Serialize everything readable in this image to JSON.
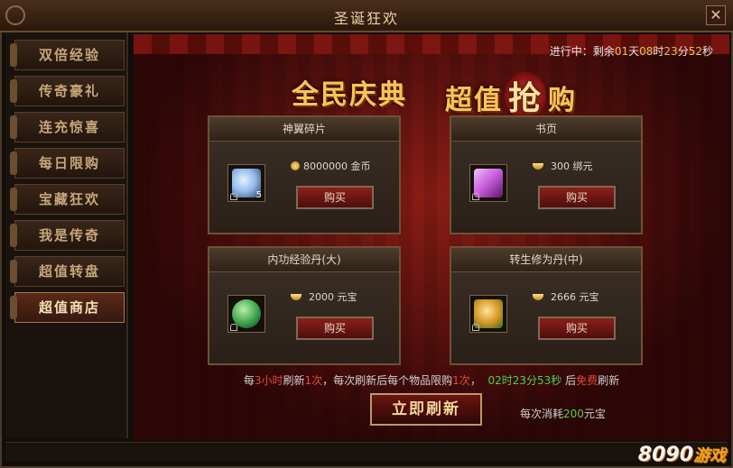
{
  "window": {
    "title": "圣诞狂欢"
  },
  "sidebar": {
    "items": [
      {
        "label": "双倍经验"
      },
      {
        "label": "传奇豪礼"
      },
      {
        "label": "连充惊喜"
      },
      {
        "label": "每日限购"
      },
      {
        "label": "宝藏狂欢"
      },
      {
        "label": "我是传奇"
      },
      {
        "label": "超值转盘"
      },
      {
        "label": "超值商店",
        "active": true
      }
    ]
  },
  "timer": {
    "prefix": "进行中：剩余",
    "days": "01",
    "d_unit": "天",
    "hours": "08",
    "h_unit": "时",
    "minutes": "23",
    "m_unit": "分",
    "seconds": "52",
    "s_unit": "秒"
  },
  "banner": {
    "left": "全民庆典",
    "right_a": "超值",
    "right_big": "抢",
    "right_b": "购"
  },
  "shop": {
    "items": [
      {
        "name": "神翼碎片",
        "count": "5",
        "price": "8000000",
        "currency": "金币",
        "buy": "购买",
        "icon": "wing-icon",
        "art_color": "#8fb6e8"
      },
      {
        "name": "书页",
        "count": "",
        "price": "300",
        "currency": "绑元",
        "buy": "购买",
        "icon": "scroll-icon",
        "art_color": "#c45ad8"
      },
      {
        "name": "内功经验丹(大)",
        "count": "",
        "price": "2000",
        "currency": "元宝",
        "buy": "购买",
        "icon": "green-orb-icon",
        "art_color": "#3aa14a"
      },
      {
        "name": "转生修为丹(中)",
        "count": "",
        "price": "2666",
        "currency": "元宝",
        "buy": "购买",
        "icon": "gold-pill-icon",
        "art_color": "#d89a2a"
      }
    ]
  },
  "refresh_note": {
    "p1": "每",
    "hours": "3小时",
    "p2": "刷新",
    "times": "1次",
    "p3": "，每次刷新后每个物品限购",
    "limit": "1次",
    "p4": "，",
    "countdown": "02时23分53秒",
    "p5": " 后",
    "free": "免费",
    "p6": "刷新"
  },
  "refresh_button": {
    "label": "立即刷新"
  },
  "cost": {
    "prefix": "每次消耗",
    "amount": "200",
    "unit": "元宝"
  },
  "watermark": {
    "num": "8090",
    "game": "游戏"
  },
  "colors": {
    "accent_gold": "#f7c45a",
    "highlight_green": "#4ecf4e",
    "highlight_red": "#e04a3a"
  }
}
